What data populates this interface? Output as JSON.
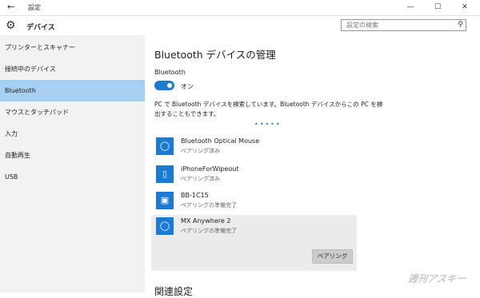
{
  "titlebar": {
    "back_icon": "back-arrow-icon",
    "title": "設定",
    "minimize": "—",
    "maximize": "☐",
    "close": "✕"
  },
  "header": {
    "title": "デバイス",
    "icon": "gear-icon"
  },
  "search": {
    "placeholder": "設定の検索",
    "icon": "search-icon"
  },
  "sidebar": {
    "items": [
      {
        "label": "プリンターとスキャナー",
        "selected": false
      },
      {
        "label": "接続中のデバイス",
        "selected": false
      },
      {
        "label": "Bluetooth",
        "selected": true
      },
      {
        "label": "マウスとタッチパッド",
        "selected": false
      },
      {
        "label": "入力",
        "selected": false
      },
      {
        "label": "自動再生",
        "selected": false
      },
      {
        "label": "USB",
        "selected": false
      }
    ]
  },
  "main": {
    "title": "Bluetooth デバイスの管理",
    "bluetooth_label": "Bluetooth",
    "toggle_state": "オン",
    "description": "PC で Bluetooth デバイスを検索しています。Bluetooth デバイスからこの PC を検出することもできます。",
    "progress_dots": "•••••",
    "devices": [
      {
        "name": "Bluetooth Optical Mouse",
        "status": "ペアリング済み",
        "icon": "mouse-icon"
      },
      {
        "name": "iPhoneForWipeout",
        "status": "ペアリング済み",
        "icon": "phone-icon"
      },
      {
        "name": "BB-1C15",
        "status": "ペアリングの準備完了",
        "icon": "device-icon"
      },
      {
        "name": "MX Anywhere 2",
        "status": "ペアリングの準備完了",
        "icon": "mouse-icon"
      }
    ],
    "pair_button": "ペアリング",
    "related_heading": "関連設定"
  },
  "watermark": "週刊アスキー",
  "colors": {
    "accent": "#1a7ad4",
    "sidebar_bg": "#f2f2f2",
    "sidebar_selected": "#a7cff0",
    "selected_device_bg": "#ececec"
  }
}
